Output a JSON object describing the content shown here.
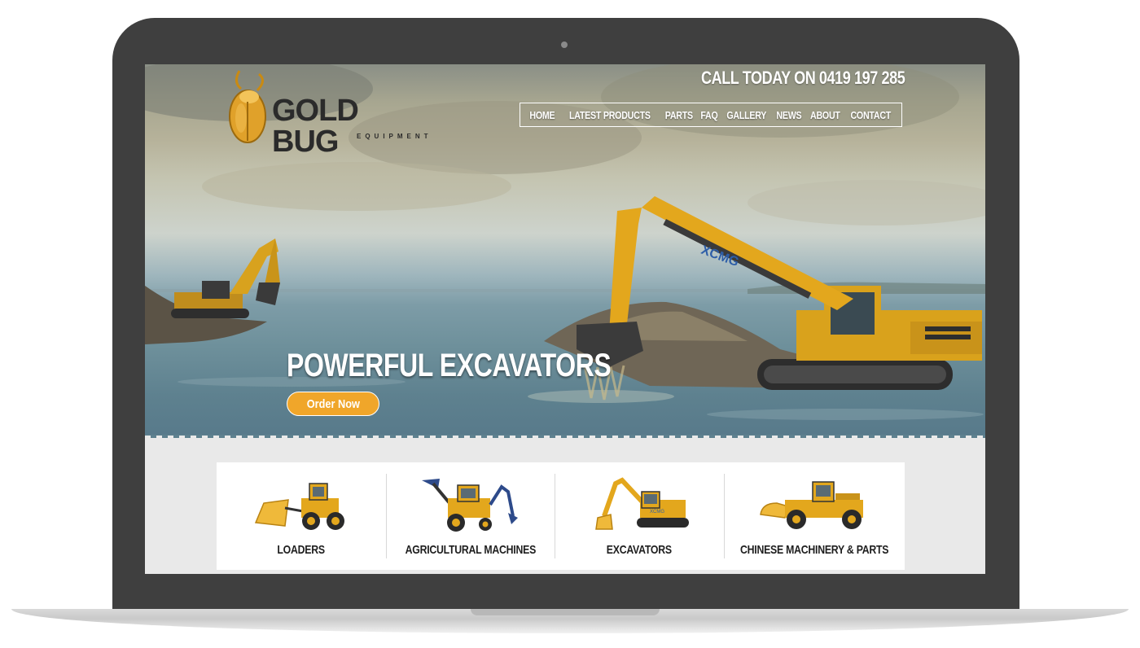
{
  "site": {
    "logo_main": "GOLD BUG",
    "logo_sub": "EQUIPMENT",
    "phone_text": "CALL TODAY ON 0419 197 285"
  },
  "nav": {
    "items": [
      "HOME",
      "LATEST PRODUCTS",
      "PARTS",
      "FAQ",
      "GALLERY",
      "NEWS",
      "ABOUT",
      "CONTACT"
    ]
  },
  "hero": {
    "headline": "POWERFUL EXCAVATORS",
    "button_label": "Order Now",
    "machine_brand": "XCMG"
  },
  "categories": [
    {
      "label": "LOADERS",
      "icon": "wheel-loader-icon"
    },
    {
      "label": "AGRICULTURAL MACHINES",
      "icon": "backhoe-loader-icon"
    },
    {
      "label": "EXCAVATORS",
      "icon": "excavator-icon"
    },
    {
      "label": "CHINESE MACHINERY & PARTS",
      "icon": "loader-parts-icon"
    }
  ],
  "colors": {
    "accent": "#f0a62a",
    "frame": "#3f3f3f",
    "strip_bg": "#e9e9e9",
    "machine_yellow": "#e3a71d"
  }
}
